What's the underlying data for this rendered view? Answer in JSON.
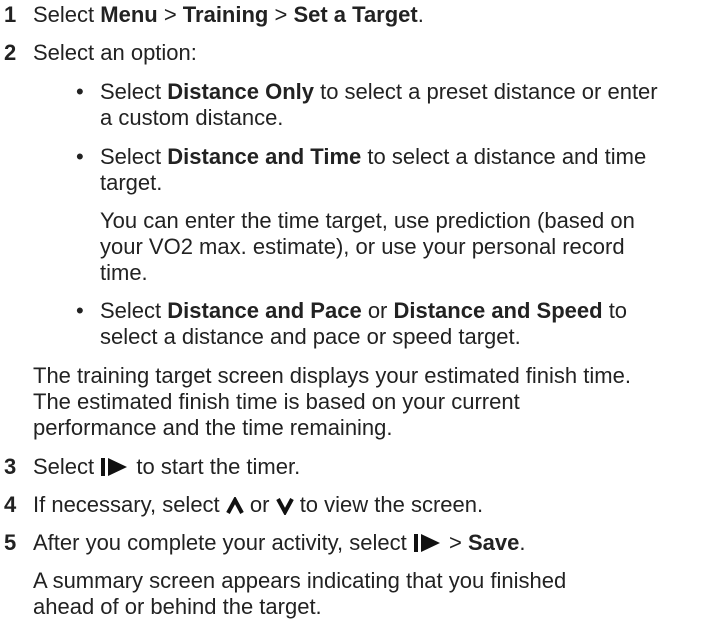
{
  "steps": [
    {
      "number": "1",
      "pre": "Select ",
      "b1": "Menu",
      "sep1": " > ",
      "b2": "Training",
      "sep2": " > ",
      "b3": "Set a Target",
      "post": "."
    },
    {
      "number": "2",
      "text": "Select an option:",
      "options": [
        {
          "pre": "Select ",
          "bold": "Distance Only",
          "post": " to select a preset distance or enter",
          "cont": "a custom distance."
        },
        {
          "pre": "Select ",
          "bold": "Distance and Time",
          "post": " to select a distance and time",
          "cont": "target."
        },
        {
          "pre": "Select ",
          "bold1": "Distance and Pace",
          "mid": " or ",
          "bold2": "Distance and Speed",
          "post": " to",
          "cont": "select a distance and pace or speed target."
        }
      ],
      "time_note": [
        "You can enter the time target, use prediction (based on",
        "your VO2 max. estimate), or use your personal record",
        "time."
      ],
      "screen_note": [
        "The training target screen displays your estimated finish time.",
        "The estimated finish time is based on your current",
        "performance and the time remaining."
      ]
    },
    {
      "number": "3",
      "pre": "Select ",
      "post": " to start the timer.",
      "icon": "start-stop-icon"
    },
    {
      "number": "4",
      "pre": "If necessary, select ",
      "mid": " or ",
      "post": " to view the screen.",
      "icons": [
        "up-icon",
        "down-icon"
      ]
    },
    {
      "number": "5",
      "pre": "After you complete your activity, select ",
      "sep": " > ",
      "bold": "Save",
      "post": ".",
      "icon": "start-stop-icon",
      "note": [
        "A summary screen appears indicating that you finished",
        "ahead of or behind the target."
      ]
    }
  ]
}
